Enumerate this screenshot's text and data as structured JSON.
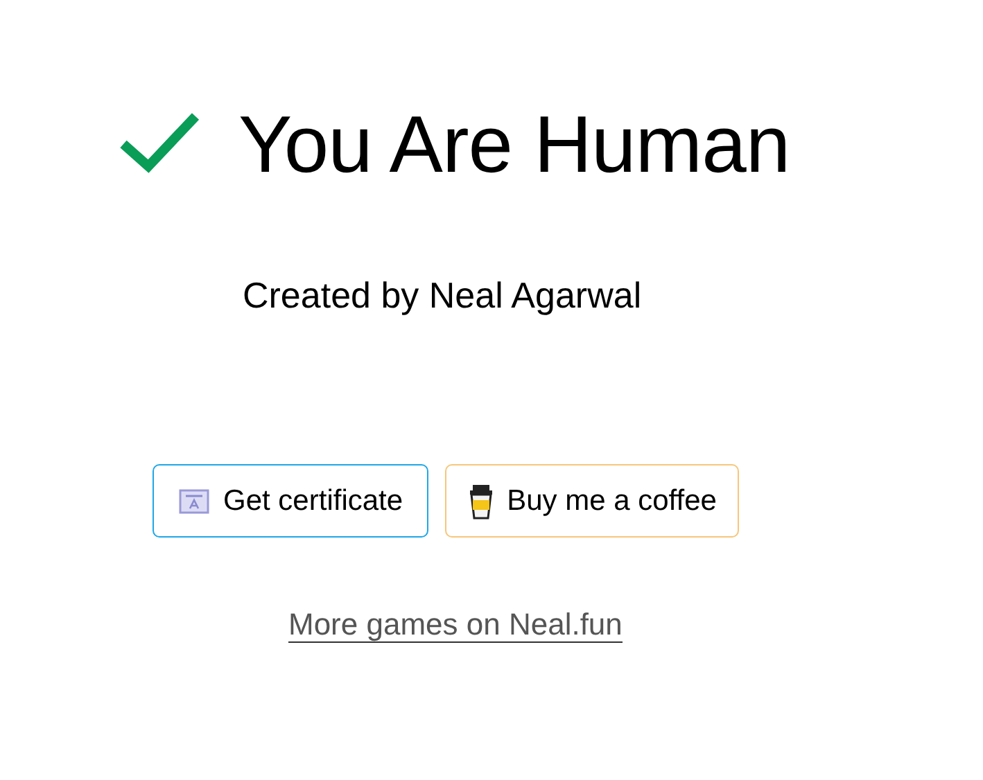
{
  "title": "You Are Human",
  "subtitle": "Created by Neal Agarwal",
  "buttons": [
    {
      "label": "Get certificate",
      "kind": "certificate"
    },
    {
      "label": "Buy me a coffee",
      "kind": "coffee"
    }
  ],
  "link": "More games on Neal.fun"
}
